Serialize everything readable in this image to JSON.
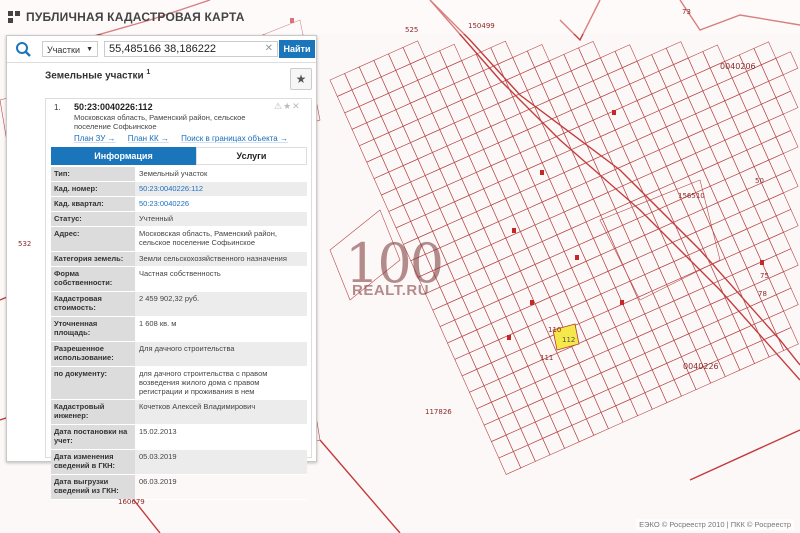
{
  "header": {
    "title": "ПУБЛИЧНАЯ КАДАСТРОВАЯ КАРТА"
  },
  "search": {
    "type_label": "Участки",
    "query": "55,485166 38,186222",
    "find_label": "Найти"
  },
  "section": {
    "title": "Земельные участки",
    "count": "1"
  },
  "card": {
    "index": "1.",
    "number": "50:23:0040226:112",
    "address": "Московская область, Раменский район, сельское поселение Софьинское",
    "links": [
      "План ЗУ →",
      "План КК →",
      "Поиск в границах объекта →"
    ],
    "tabs": [
      "Информация",
      "Услуги"
    ],
    "rows": [
      {
        "key": "Тип:",
        "value": "Земельный участок"
      },
      {
        "key": "Кад. номер:",
        "value": "50:23:0040226:112"
      },
      {
        "key": "Кад. квартал:",
        "value": "50:23:0040226"
      },
      {
        "key": "Статус:",
        "value": "Учтенный"
      },
      {
        "key": "Адрес:",
        "value": "Московская область, Раменский район, сельское поселение Софьинское"
      },
      {
        "key": "Категория земель:",
        "value": "Земли сельскохозяйственного назначения"
      },
      {
        "key": "Форма собственности:",
        "value": "Частная собственность"
      },
      {
        "key": "Кадастровая стоимость:",
        "value": "2 459 902,32 руб."
      },
      {
        "key": "Уточненная площадь:",
        "value": "1 608 кв. м"
      },
      {
        "key": "Разрешенное использование:",
        "value": "Для дачного строительства"
      },
      {
        "key": "по документу:",
        "value": "для дачного строительства с правом возведения жилого дома с правом регистрации и проживания в нем"
      },
      {
        "key": "Кадастровый инженер:",
        "value": "Кочетков Алексей Владимирович"
      },
      {
        "key": "Дата постановки на учет:",
        "value": "15.02.2013"
      },
      {
        "key": "Дата изменения сведений в ГКН:",
        "value": "05.03.2019"
      },
      {
        "key": "Дата выгрузки сведений из ГКН:",
        "value": "06.03.2019"
      }
    ]
  },
  "map_labels": {
    "a": "150499",
    "b": "525",
    "c": "0040206",
    "d": "0040226",
    "e": "117826",
    "f": "532",
    "g": "160679",
    "h": "112",
    "i": "110",
    "j": "111",
    "k": "73",
    "l": "156510",
    "m": "50",
    "n": "75",
    "o": "78"
  },
  "watermark": {
    "big": "100",
    "small": "REALT.RU"
  },
  "footer": {
    "text": "ЕЭКО © Росреестр 2010 | ПКК © Росреестр"
  },
  "colors": {
    "accent": "#1b75bb",
    "parcel_line": "#b23a3a",
    "selected_parcel": "#f5e84a"
  }
}
